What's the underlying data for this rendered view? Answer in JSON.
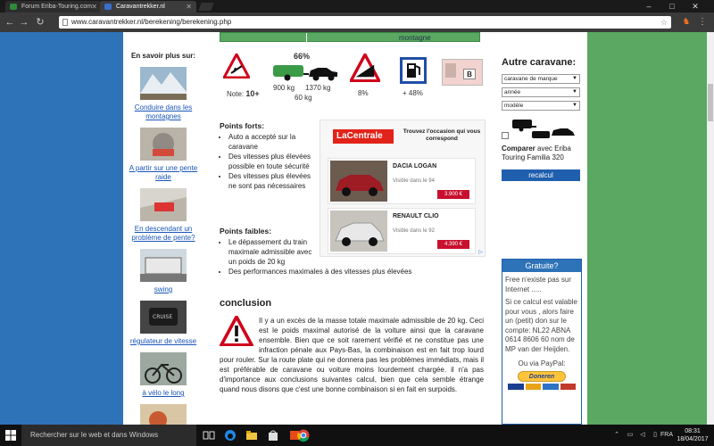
{
  "browser": {
    "tabs": [
      {
        "label": "Forum Eriba-Touring.com",
        "active": false
      },
      {
        "label": "Caravantrekker.nl",
        "active": true
      }
    ],
    "url": "www.caravantrekker.nl/berekening/berekening.php",
    "window_buttons": {
      "minimize": "–",
      "maximize": "□",
      "close": "✕"
    }
  },
  "page": {
    "top_bar_label": "montagne",
    "left": {
      "heading": "En savoir plus sur:",
      "links": [
        "Conduire dans les montagnes",
        "A partir sur une pente raide",
        "En descendant un problème de pente?",
        "swing",
        "régulateur de vitesse",
        "à vélo le long"
      ]
    },
    "icons": {
      "note_label": "Note:",
      "note_value": "10+",
      "ratio_pct": "66%",
      "weight_left": "900 kg",
      "weight_right": "1370 kg",
      "weight_sub": "60 kg",
      "slope_pct": "8%",
      "fuel_pct": "+ 48%",
      "licence_letter": "B"
    },
    "strong": {
      "title": "Points forts:",
      "items": [
        "Auto a accepté sur la caravane",
        "Des vitesses plus élevées possible en toute sécurité",
        "Des vitesses plus élevées ne sont pas nécessaires"
      ]
    },
    "weak": {
      "title": "Points faibles:",
      "items": [
        "Le dépassement du train maximale admissible avec un poids de 20 kg",
        "Des performances maximales à des vitesses plus élevées"
      ]
    },
    "conclusion": {
      "title": "conclusion",
      "text": "Il y a un excès de la masse totale maximale admissible de 20 kg. Ceci est le poids maximal autorisé de la voiture ainsi que la caravane ensemble. Bien que ce soit rarement vérifié et ne constitue pas une infraction pénale aux Pays-Bas, la combinaison est en fait trop lourd pour rouler. Sur la route plate qui ne donnera pas les problèmes immédiats, mais il est préférable de caravane ou voiture moins lourdement chargée. il n'a pas d'importance aux conclusions suivantes calcul, bien que cela semble étrange quand nous disons que c'est une bonne combinaison si en fait en surpoids."
    },
    "ad": {
      "brand": "LaCentrale",
      "slogan": "Trouvez l'occasion qui vous correspond",
      "cards": [
        {
          "model": "DACIA LOGAN",
          "visible": "Visible dans le 94",
          "price": "3.900 €"
        },
        {
          "model": "RENAULT CLIO",
          "visible": "Visible dans le 92",
          "price": "4.390 €"
        }
      ]
    },
    "right": {
      "heading": "Autre caravane:",
      "selects": [
        "caravane de marque",
        "année",
        "modèle"
      ],
      "compare_bold": "Comparer",
      "compare_rest": " avec Eriba Touring Familia 320",
      "recalc": "recalcul",
      "gratuite": {
        "title": "Gratuite?",
        "p1": "Free n'existe pas sur Internet .....",
        "p2": "Si ce calcul est valable pour vous , alors faire un (petit) don sur le compte: NL22 ABNA 0614 8606 60 nom de MP van der Heijden.",
        "paypal_label": "Ou via PayPal:",
        "paypal_button": "Doneren"
      }
    }
  },
  "taskbar": {
    "search_placeholder": "Rechercher sur le web et dans Windows",
    "lang": "FRA",
    "time": "08:31",
    "date": "18/04/2017"
  },
  "colors": {
    "left_bg": "#2e72b8",
    "right_bg": "#5aa862",
    "warning_red": "#d0021b",
    "link": "#1a56b8"
  }
}
